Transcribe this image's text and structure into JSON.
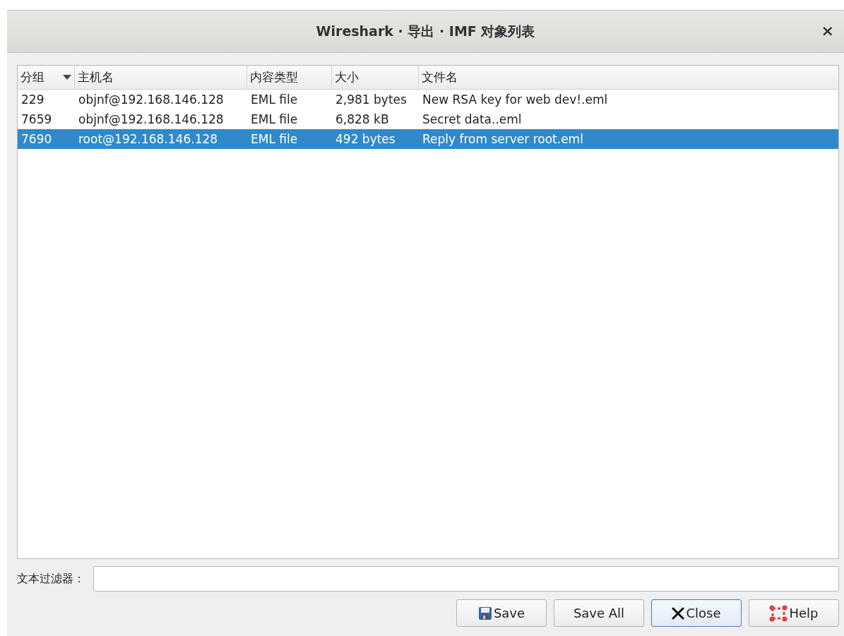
{
  "window": {
    "title": "Wireshark · 导出 · IMF 对象列表",
    "close": "×"
  },
  "table": {
    "columns": [
      {
        "label": "分组",
        "sorted": true
      },
      {
        "label": "主机名",
        "sorted": false
      },
      {
        "label": "内容类型",
        "sorted": false
      },
      {
        "label": "大小",
        "sorted": false
      },
      {
        "label": "文件名",
        "sorted": false
      }
    ],
    "rows": [
      {
        "cells": [
          "229",
          "objnf@192.168.146.128",
          "EML file",
          "2,981 bytes",
          "New RSA key for web dev!.eml"
        ],
        "selected": false
      },
      {
        "cells": [
          "7659",
          "objnf@192.168.146.128",
          "EML file",
          "6,828 kB",
          "Secret data..eml"
        ],
        "selected": false
      },
      {
        "cells": [
          "7690",
          "root@192.168.146.128",
          "EML file",
          "492 bytes",
          "Reply from server root.eml"
        ],
        "selected": true
      }
    ]
  },
  "filter": {
    "label": "文本过滤器："
  },
  "buttons": [
    {
      "label": "Save",
      "kind": "save",
      "default": false
    },
    {
      "label": "Save All",
      "kind": "plain",
      "default": false
    },
    {
      "label": "Close",
      "kind": "close",
      "default": true
    },
    {
      "label": "Help",
      "kind": "help",
      "default": false
    }
  ]
}
